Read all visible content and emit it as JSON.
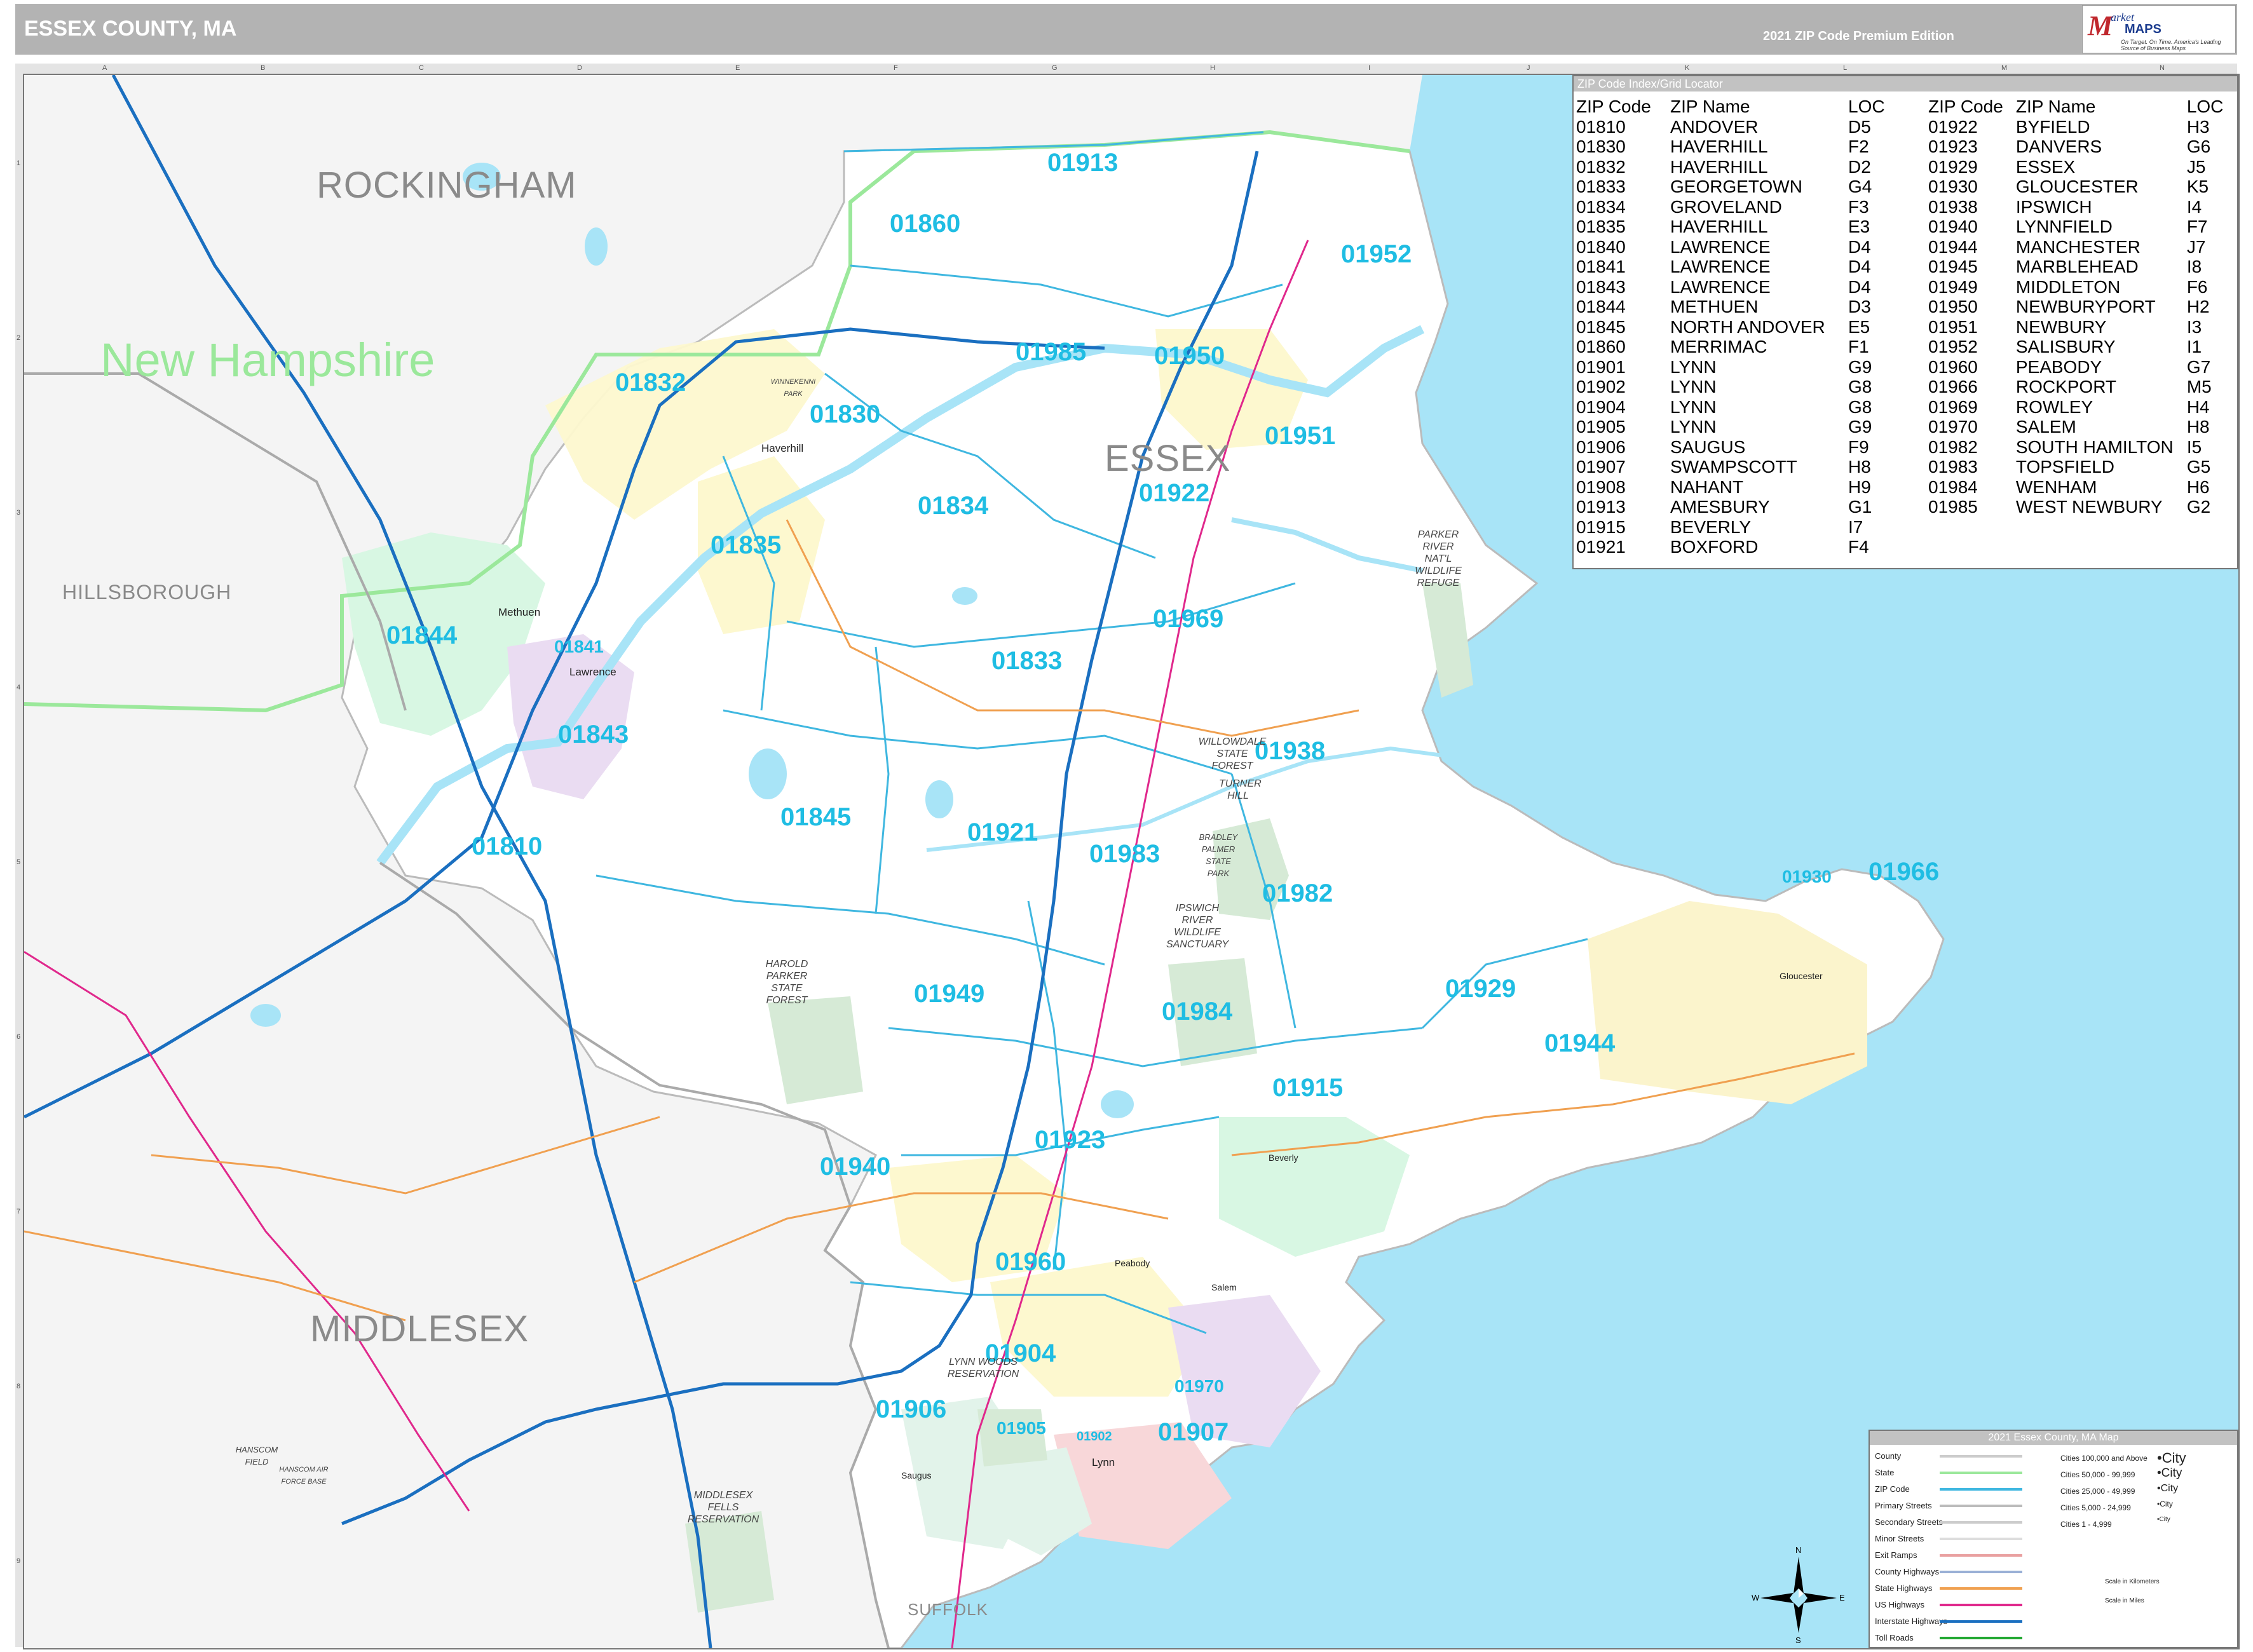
{
  "header": {
    "title": "ESSEX COUNTY, MA",
    "edition": "2021 ZIP Code Premium Edition",
    "logo_brand_m": "M",
    "logo_brand_arket": "arket",
    "logo_brand_maps": "MAPS",
    "logo_tagline": "On Target. On Time. America's Leading Source of Business Maps"
  },
  "grid": {
    "columns": [
      "A",
      "B",
      "C",
      "D",
      "E",
      "F",
      "G",
      "H",
      "I",
      "J",
      "K",
      "L",
      "M",
      "N"
    ],
    "rows": [
      "1",
      "2",
      "3",
      "4",
      "5",
      "6",
      "7",
      "8",
      "9"
    ]
  },
  "map": {
    "counties": [
      "ROCKINGHAM",
      "ESSEX",
      "HILLSBOROUGH",
      "MIDDLESEX",
      "SUFFOLK"
    ],
    "state": "New Hampshire",
    "zip_labels": [
      "01913",
      "01860",
      "01952",
      "01985",
      "01950",
      "01832",
      "01830",
      "01951",
      "01834",
      "01922",
      "01835",
      "01969",
      "01844",
      "01841",
      "01833",
      "01843",
      "01938",
      "01845",
      "01921",
      "01983",
      "01810",
      "01982",
      "01930",
      "01966",
      "01929",
      "01949",
      "01984",
      "01944",
      "01915",
      "01923",
      "01940",
      "01960",
      "01904",
      "01970",
      "01906",
      "01905",
      "01902",
      "01907"
    ],
    "cities": [
      "Haverhill",
      "Methuen",
      "Lawrence",
      "Beverly",
      "Peabody",
      "Salem",
      "Lynn",
      "Saugus",
      "Gloucester"
    ],
    "parks": [
      "PARKER RIVER NAT'L WILDLIFE REFUGE",
      "WILLOWDALE STATE FOREST",
      "TURNER HILL",
      "BRADLEY PALMER STATE PARK",
      "IPSWICH RIVER WILDLIFE SANCTUARY",
      "HAROLD PARKER STATE FOREST",
      "LYNN WOODS RESERVATION",
      "MIDDLESEX FELLS RESERVATION",
      "HANSCOM FIELD",
      "HANSCOM AIR FORCE BASE",
      "WINNEKENNI PARK"
    ]
  },
  "zip_index": {
    "title": "ZIP Code Index/Grid Locator",
    "columns": [
      "ZIP Code",
      "ZIP Name",
      "LOC"
    ],
    "left": [
      [
        "01810",
        "ANDOVER",
        "D5"
      ],
      [
        "01830",
        "HAVERHILL",
        "F2"
      ],
      [
        "01832",
        "HAVERHILL",
        "D2"
      ],
      [
        "01833",
        "GEORGETOWN",
        "G4"
      ],
      [
        "01834",
        "GROVELAND",
        "F3"
      ],
      [
        "01835",
        "HAVERHILL",
        "E3"
      ],
      [
        "01840",
        "LAWRENCE",
        "D4"
      ],
      [
        "01841",
        "LAWRENCE",
        "D4"
      ],
      [
        "01843",
        "LAWRENCE",
        "D4"
      ],
      [
        "01844",
        "METHUEN",
        "D3"
      ],
      [
        "01845",
        "NORTH ANDOVER",
        "E5"
      ],
      [
        "01860",
        "MERRIMAC",
        "F1"
      ],
      [
        "01901",
        "LYNN",
        "G9"
      ],
      [
        "01902",
        "LYNN",
        "G8"
      ],
      [
        "01904",
        "LYNN",
        "G8"
      ],
      [
        "01905",
        "LYNN",
        "G9"
      ],
      [
        "01906",
        "SAUGUS",
        "F9"
      ],
      [
        "01907",
        "SWAMPSCOTT",
        "H8"
      ],
      [
        "01908",
        "NAHANT",
        "H9"
      ],
      [
        "01913",
        "AMESBURY",
        "G1"
      ],
      [
        "01915",
        "BEVERLY",
        "I7"
      ],
      [
        "01921",
        "BOXFORD",
        "F4"
      ]
    ],
    "right": [
      [
        "01922",
        "BYFIELD",
        "H3"
      ],
      [
        "01923",
        "DANVERS",
        "G6"
      ],
      [
        "01929",
        "ESSEX",
        "J5"
      ],
      [
        "01930",
        "GLOUCESTER",
        "K5"
      ],
      [
        "01938",
        "IPSWICH",
        "I4"
      ],
      [
        "01940",
        "LYNNFIELD",
        "F7"
      ],
      [
        "01944",
        "MANCHESTER",
        "J7"
      ],
      [
        "01945",
        "MARBLEHEAD",
        "I8"
      ],
      [
        "01949",
        "MIDDLETON",
        "F6"
      ],
      [
        "01950",
        "NEWBURYPORT",
        "H2"
      ],
      [
        "01951",
        "NEWBURY",
        "I3"
      ],
      [
        "01952",
        "SALISBURY",
        "I1"
      ],
      [
        "01960",
        "PEABODY",
        "G7"
      ],
      [
        "01966",
        "ROCKPORT",
        "M5"
      ],
      [
        "01969",
        "ROWLEY",
        "H4"
      ],
      [
        "01970",
        "SALEM",
        "H8"
      ],
      [
        "01982",
        "SOUTH HAMILTON",
        "I5"
      ],
      [
        "01983",
        "TOPSFIELD",
        "G5"
      ],
      [
        "01984",
        "WENHAM",
        "H6"
      ],
      [
        "01985",
        "WEST NEWBURY",
        "G2"
      ]
    ]
  },
  "legend": {
    "title": "2021 Essex County, MA Map",
    "items": [
      {
        "label": "County",
        "color": "#cccccc"
      },
      {
        "label": "State",
        "color": "#9be89b"
      },
      {
        "label": "ZIP Code",
        "color": "#3fb7e0"
      },
      {
        "label": "Primary Streets",
        "color": "#bbbbbb"
      },
      {
        "label": "Secondary Streets",
        "color": "#cccccc"
      },
      {
        "label": "Minor Streets",
        "color": "#dddddd"
      },
      {
        "label": "Exit Ramps",
        "color": "#e9a0a0"
      },
      {
        "label": "County Highways",
        "color": "#9ab0d6"
      },
      {
        "label": "State Highways",
        "color": "#f0a050"
      },
      {
        "label": "US Highways",
        "color": "#e0288c"
      },
      {
        "label": "Interstate Highways",
        "color": "#1a6fc0"
      },
      {
        "label": "Toll Roads",
        "color": "#22a832"
      }
    ],
    "city_classes": [
      {
        "label": "Cities 100,000 and Above",
        "sample": "City"
      },
      {
        "label": "Cities 50,000 - 99,999",
        "sample": "City"
      },
      {
        "label": "Cities 25,000 - 49,999",
        "sample": "City"
      },
      {
        "label": "Cities 5,000 - 24,999",
        "sample": "City"
      },
      {
        "label": "Cities 1 - 4,999",
        "sample": "City"
      }
    ],
    "scale_km": "Scale in Kilometers",
    "scale_mi": "Scale in Miles"
  },
  "compass": {
    "n": "N",
    "s": "S",
    "e": "E",
    "w": "W"
  },
  "colors": {
    "water": "#a8e4f7",
    "land": "#f4f4f4",
    "essex_land": "#ffffff",
    "zip_line": "#3fb7e0",
    "interstate": "#1a6fc0",
    "us_highway": "#e0288c",
    "state_line": "#9be89b"
  }
}
